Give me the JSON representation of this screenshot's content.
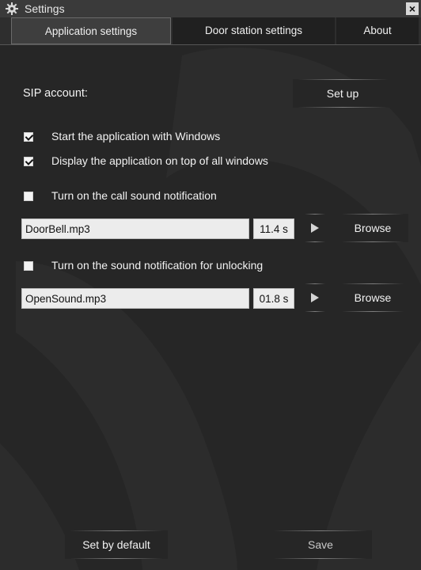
{
  "window": {
    "title": "Settings",
    "close_glyph": "×"
  },
  "tabs": [
    {
      "label": "Application settings",
      "active": true
    },
    {
      "label": "Door station settings",
      "active": false
    },
    {
      "label": "About",
      "active": false
    }
  ],
  "sip": {
    "label": "SIP account:",
    "button": "Set up"
  },
  "options": {
    "start_with_windows": {
      "label": "Start the application with Windows",
      "checked": true
    },
    "on_top": {
      "label": "Display the application on top of all windows",
      "checked": true
    },
    "call_sound": {
      "label": "Turn on the call sound notification",
      "checked": false
    },
    "unlock_sound": {
      "label": "Turn on the sound notification for unlocking",
      "checked": false
    }
  },
  "call_sound": {
    "file": "DoorBell.mp3",
    "duration": "11.4 s",
    "browse": "Browse"
  },
  "unlock_sound": {
    "file": "OpenSound.mp3",
    "duration": "01.8 s",
    "browse": "Browse"
  },
  "footer": {
    "default_button": "Set by default",
    "save_button": "Save"
  },
  "icons": [
    "gear-icon",
    "close-icon",
    "play-icon",
    "checkbox-check-icon"
  ],
  "colors": {
    "background": "#262626",
    "titlebar": "#3a3a3a",
    "text": "#f2f2f2",
    "field": "#ececec"
  }
}
